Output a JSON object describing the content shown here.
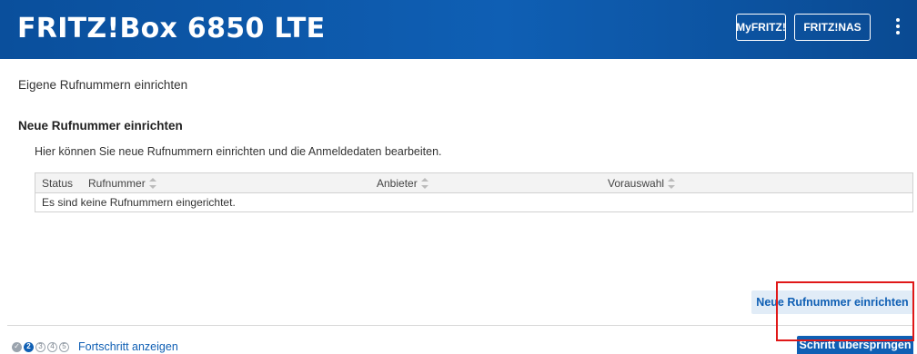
{
  "header": {
    "brand": "FRITZ!Box 6850 LTE",
    "buttons": {
      "myfritz": "MyFRITZ!",
      "nas": "FRITZ!NAS"
    },
    "menu_icon": "vertical-dots-icon"
  },
  "page": {
    "title": "Eigene Rufnummern einrichten",
    "section_title": "Neue Rufnummer einrichten",
    "description": "Hier können Sie neue Rufnummern einrichten und die Anmeldedaten bearbeiten."
  },
  "table": {
    "columns": [
      "Status",
      "Rufnummer",
      "Anbieter",
      "Vorauswahl"
    ],
    "empty_message": "Es sind keine Rufnummern eingerichtet."
  },
  "actions": {
    "new_number": "Neue Rufnummer einrichten",
    "skip_step": "Schritt überspringen"
  },
  "progress": {
    "steps": [
      "✓",
      "2",
      "3",
      "4",
      "5"
    ],
    "current_step": 2,
    "link": "Fortschritt anzeigen"
  },
  "colors": {
    "header_blue": "#0f5fb4",
    "highlight_red": "#e01818"
  }
}
